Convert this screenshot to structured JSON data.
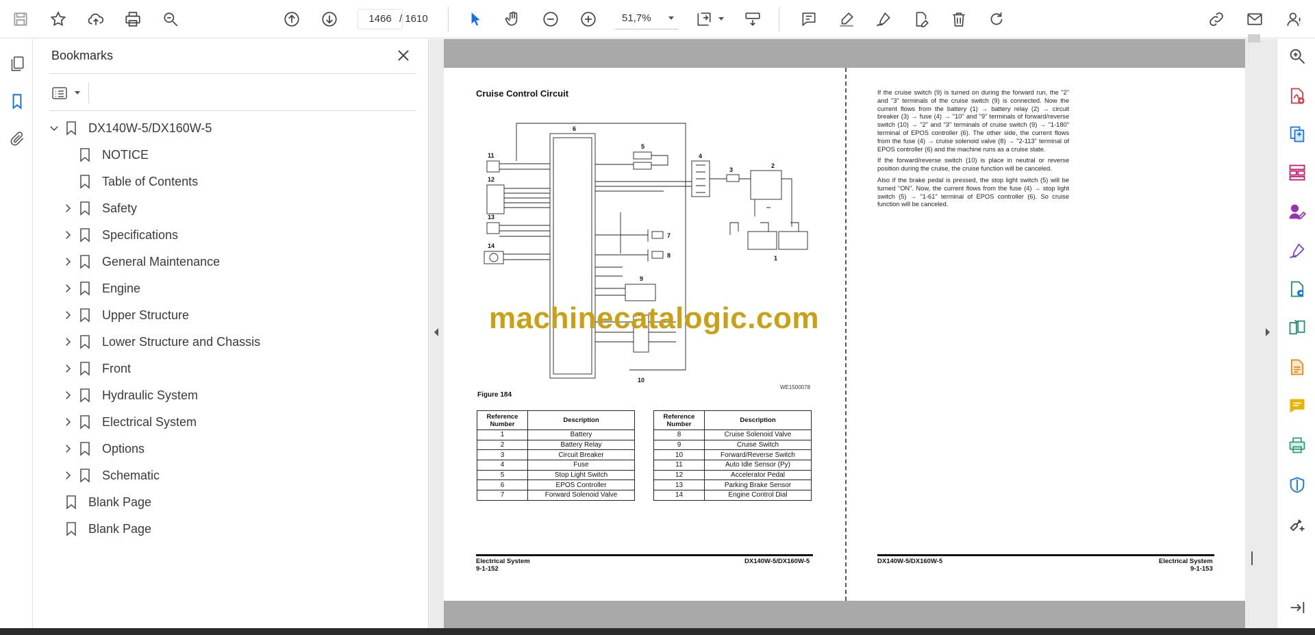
{
  "toolbar": {
    "current_page": "1466",
    "total_pages": "/ 1610",
    "zoom": "51,7%"
  },
  "bookmarks": {
    "title": "Bookmarks",
    "items": [
      {
        "label": "DX140W-5/DX160W-5",
        "expanded": true
      },
      {
        "label": "NOTICE"
      },
      {
        "label": "Table of Contents"
      },
      {
        "label": "Safety"
      },
      {
        "label": "Specifications"
      },
      {
        "label": "General Maintenance"
      },
      {
        "label": "Engine"
      },
      {
        "label": "Upper Structure"
      },
      {
        "label": "Lower Structure and Chassis"
      },
      {
        "label": "Front"
      },
      {
        "label": "Hydraulic System"
      },
      {
        "label": "Electrical System"
      },
      {
        "label": "Options"
      },
      {
        "label": "Schematic"
      },
      {
        "label": "Blank Page"
      },
      {
        "label": "Blank Page"
      }
    ]
  },
  "document": {
    "left_page": {
      "title": "Cruise Control Circuit",
      "figure_label": "Figure 184",
      "figure_code": "WE1500078",
      "watermark": "machinecatalogic.com",
      "table_headers": {
        "ref": "Reference Number",
        "desc": "Description"
      },
      "table_left": [
        {
          "num": "1",
          "desc": "Battery"
        },
        {
          "num": "2",
          "desc": "Battery Relay"
        },
        {
          "num": "3",
          "desc": "Circuit Breaker"
        },
        {
          "num": "4",
          "desc": "Fuse"
        },
        {
          "num": "5",
          "desc": "Stop Light Switch"
        },
        {
          "num": "6",
          "desc": "EPOS Controller"
        },
        {
          "num": "7",
          "desc": "Forward Solenoid Valve"
        }
      ],
      "table_right": [
        {
          "num": "8",
          "desc": "Cruise Solenoid Valve"
        },
        {
          "num": "9",
          "desc": "Cruise Switch"
        },
        {
          "num": "10",
          "desc": "Forward/Reverse Switch"
        },
        {
          "num": "11",
          "desc": "Auto Idle Sensor (Py)"
        },
        {
          "num": "12",
          "desc": "Accelerator Pedal"
        },
        {
          "num": "13",
          "desc": "Parking Brake Sensor"
        },
        {
          "num": "14",
          "desc": "Engine Control Dial"
        }
      ],
      "footer_section": "Electrical System",
      "footer_page": "9-1-152",
      "footer_model": "DX140W-5/DX160W-5",
      "diagram_labels": [
        "6",
        "5",
        "4",
        "3",
        "2",
        "1",
        "7",
        "8",
        "9",
        "10",
        "11",
        "12",
        "13",
        "14"
      ]
    },
    "right_page": {
      "paragraphs": [
        "If the cruise switch (9) is turned on during the forward run, the \"2\" and \"3\" terminals of the cruise switch (9) is connected. Now the current flows from the battery (1) → battery relay (2) → circuit breaker (3) → fuse (4) → \"10\" and \"9\" terminals of forward/reverse switch (10) → \"2\" and \"3\" terminals of cruise switch (9) → \"1-180\" terminal of EPOS controller (6). The other side, the current flows from the fuse (4) → cruise solenoid valve (8) → \"2-113\" terminal of EPOS controller (6) and the machine runs as a cruise state.",
        "If the forward/reverse switch (10) is place in neutral or reverse position during the cruise, the cruise function will be canceled.",
        "Also if the brake pedal is pressed, the stop light switch (5) will be turned \"ON\". Now, the current flows from the fuse (4) → stop light switch (5) → \"1-61\" terminal of EPOS controller (6). So cruise function will be canceled."
      ],
      "footer_model": "DX140W-5/DX160W-5",
      "footer_section": "Electrical System",
      "footer_page": "9-1-153"
    }
  },
  "colors": {
    "accent": "#1473e6",
    "rail_icon": "#c7146b",
    "watermark": "#c8a117"
  }
}
